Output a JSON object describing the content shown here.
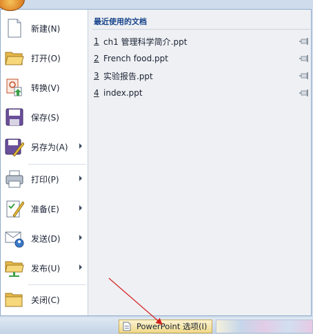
{
  "menu": {
    "items": [
      {
        "label": "新建(N)",
        "icon": "new-document-icon",
        "submenu": false
      },
      {
        "label": "打开(O)",
        "icon": "open-folder-icon",
        "submenu": false
      },
      {
        "label": "转换(V)",
        "icon": "convert-icon",
        "submenu": false
      },
      {
        "label": "保存(S)",
        "icon": "save-disk-icon",
        "submenu": false
      },
      {
        "label": "另存为(A)",
        "icon": "save-as-icon",
        "submenu": true
      },
      {
        "label": "打印(P)",
        "icon": "printer-icon",
        "submenu": true
      },
      {
        "label": "准备(E)",
        "icon": "prepare-icon",
        "submenu": true
      },
      {
        "label": "发送(D)",
        "icon": "send-icon",
        "submenu": true
      },
      {
        "label": "发布(U)",
        "icon": "publish-icon",
        "submenu": true
      },
      {
        "label": "关闭(C)",
        "icon": "close-folder-icon",
        "submenu": false
      }
    ]
  },
  "recent": {
    "header": "最近使用的文档",
    "items": [
      {
        "number": "1",
        "name": "ch1 管理科学简介.ppt"
      },
      {
        "number": "2",
        "name": "French food.ppt"
      },
      {
        "number": "3",
        "name": "实验报告.ppt"
      },
      {
        "number": "4",
        "name": "index.ppt"
      }
    ]
  },
  "footer": {
    "options_label": "PowerPoint 选项(I)"
  },
  "colors": {
    "accent": "#15428b",
    "panel_border": "#93abc9",
    "annotation_arrow": "#d42020"
  }
}
